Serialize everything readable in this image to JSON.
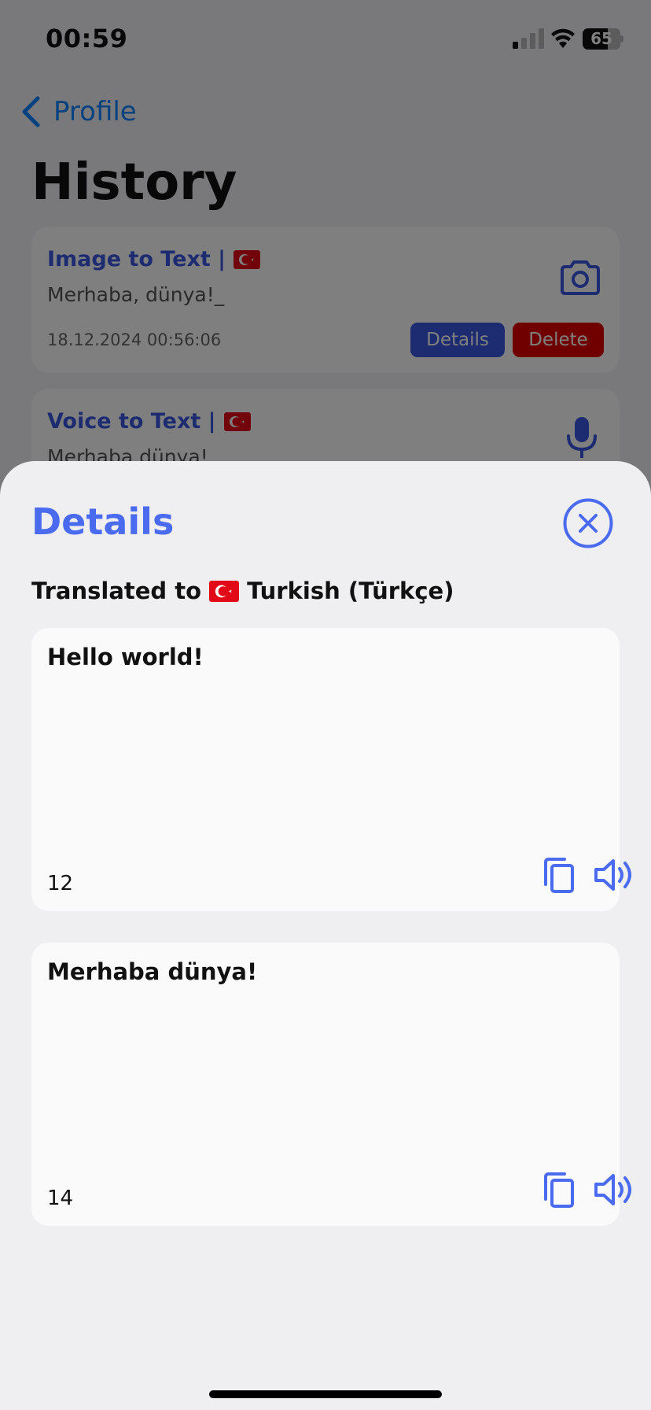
{
  "status_bar": {
    "time": "00:59",
    "battery": "65"
  },
  "nav": {
    "back_label": "Profile"
  },
  "page": {
    "title": "History"
  },
  "history": [
    {
      "title": "Image to Text |",
      "snippet": "Merhaba, dünya!_",
      "date": "18.12.2024 00:56:06",
      "details_label": "Details",
      "delete_label": "Delete",
      "icon": "camera-icon"
    },
    {
      "title": "Voice to Text |",
      "snippet": "Merhaba dünya!",
      "icon": "microphone-icon"
    }
  ],
  "sheet": {
    "title": "Details",
    "translated_prefix": "Translated to",
    "language": "Turkish (Türkçe)",
    "source": {
      "text": "Hello world!",
      "count": "12"
    },
    "target": {
      "text": "Merhaba dünya!",
      "count": "14"
    }
  },
  "colors": {
    "accent": "#4a6bf0",
    "link": "#0a84ff",
    "danger": "#e00000",
    "flag_red": "#e30a17"
  }
}
